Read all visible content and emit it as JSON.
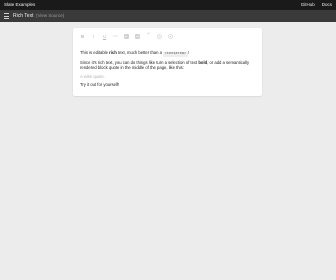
{
  "topbar": {
    "brand": "Slate Examples",
    "links": [
      "GitHub",
      "Docs"
    ]
  },
  "subbar": {
    "title": "Rich Text",
    "crumb": "(View Source)"
  },
  "toolbar": {
    "buttons": [
      {
        "name": "bold-icon",
        "glyph": "B"
      },
      {
        "name": "italic-icon",
        "glyph": "I"
      },
      {
        "name": "underline-icon",
        "glyph": "U"
      },
      {
        "name": "code-icon",
        "glyph": "<>"
      },
      {
        "name": "heading-one-icon"
      },
      {
        "name": "heading-two-icon"
      },
      {
        "name": "quote-icon",
        "glyph": "“"
      },
      {
        "name": "numbered-list-icon"
      },
      {
        "name": "bulleted-list-icon"
      }
    ]
  },
  "editor": {
    "p1": {
      "a": "This is editable ",
      "b": "rich",
      "c": " text, much better than a ",
      "code": "<textarea>",
      "d": "!"
    },
    "p2": {
      "a": "Since it's rich text, you can do things like turn a selection of text ",
      "b": "bold",
      "c": ", or add a semantically rendered block quote in the middle of the page, like this:"
    },
    "quote_placeholder": "A wise quote.",
    "p3": "Try it out for yourself!"
  }
}
